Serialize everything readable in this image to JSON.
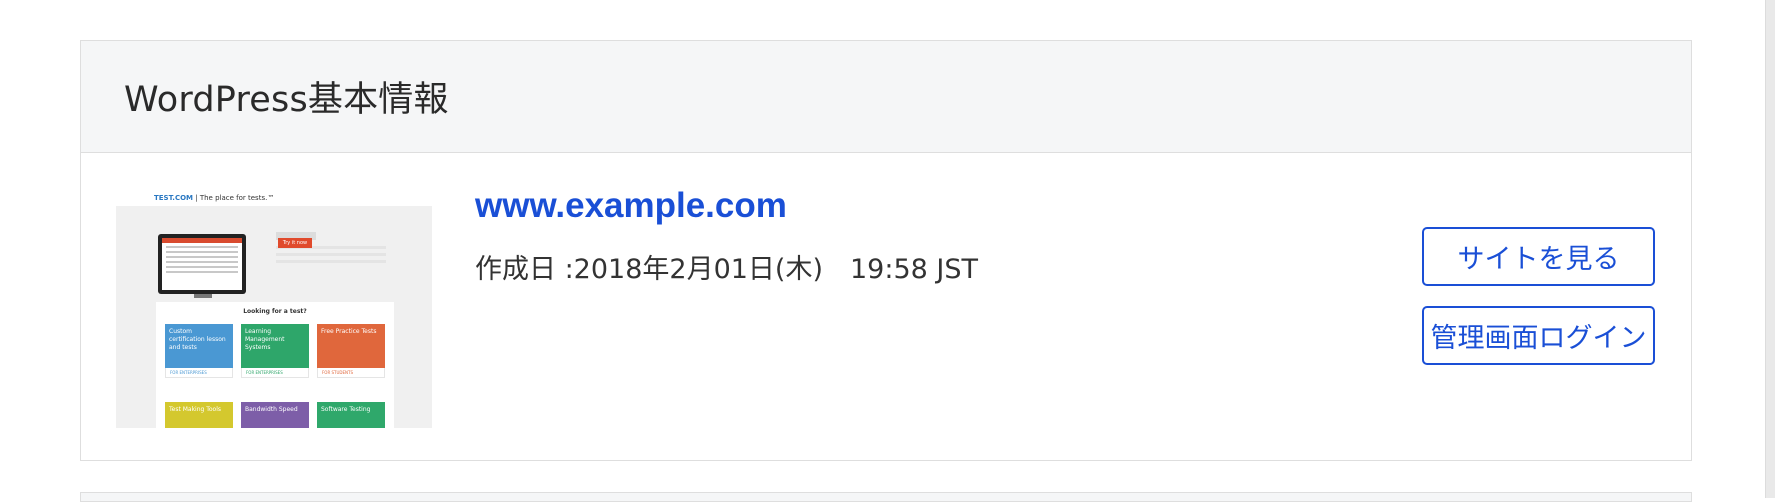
{
  "card": {
    "title": "WordPress基本情報"
  },
  "site": {
    "domain": "www.example.com",
    "created": "作成日 :2018年2月01日(木)　19:58 JST"
  },
  "buttons": {
    "view_site": "サイトを見る",
    "admin_login": "管理画面ログイン"
  },
  "thumbnail": {
    "brand": "TEST.COM",
    "tagline": "| The place for tests.™",
    "panel_title": "Looking for a test?",
    "cta": "Try it now",
    "tiles": [
      {
        "label": "Custom certification lesson and tests",
        "foot": "FOR ENTERPRISES",
        "color": "#4a98d3"
      },
      {
        "label": "Learning Management Systems",
        "foot": "FOR ENTERPRISES",
        "color": "#2ea66a"
      },
      {
        "label": "Free Practice Tests",
        "foot": "FOR STUDENTS",
        "color": "#e0673c"
      },
      {
        "label": "Test Making Tools",
        "foot": "",
        "color": "#d4c82e"
      },
      {
        "label": "Bandwidth Speed",
        "foot": "",
        "color": "#7d5ea8"
      },
      {
        "label": "Software Testing",
        "foot": "",
        "color": "#2fa86b"
      }
    ]
  },
  "colors": {
    "accent": "#1a4fd6",
    "header_bg": "#f5f6f7",
    "border": "#dedede"
  }
}
